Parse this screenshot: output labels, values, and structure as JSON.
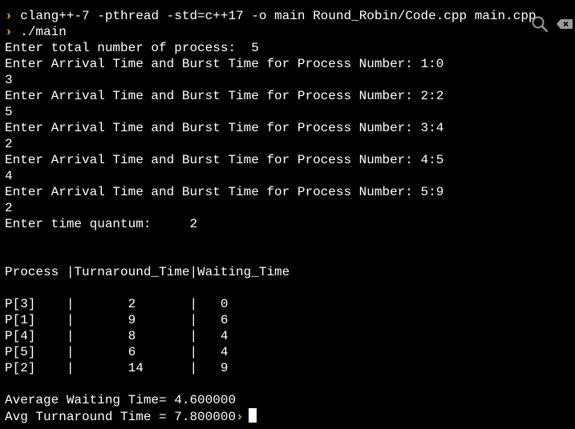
{
  "terminal": {
    "prompt_symbol": "›",
    "command1": "clang++-7 -pthread -std=c++17 -o main Round_Robin/Code.cpp main.cpp",
    "command2": "./main",
    "output": [
      "Enter total number of process:  5",
      "Enter Arrival Time and Burst Time for Process Number: 1:0",
      "3",
      "Enter Arrival Time and Burst Time for Process Number: 2:2",
      "5",
      "Enter Arrival Time and Burst Time for Process Number: 3:4",
      "2",
      "Enter Arrival Time and Burst Time for Process Number: 4:5",
      "4",
      "Enter Arrival Time and Burst Time for Process Number: 5:9",
      "2",
      "Enter time quantum:     2",
      "",
      "",
      "Process |Turnaround_Time|Waiting_Time",
      "",
      "P[3]    |       2       |   0",
      "P[1]    |       9       |   6",
      "P[4]    |       8       |   4",
      "P[5]    |       6       |   4",
      "P[2]    |       14      |   9",
      "",
      "Average Waiting Time= 4.600000",
      "Avg Turnaround Time = 7.800000"
    ]
  },
  "toolbar": {
    "search_icon": "search-icon",
    "clear_icon": "clear-icon"
  },
  "colors": {
    "background": "#000000",
    "text": "#ffffff",
    "prompt": "#f5a623",
    "icon": "#9a9a9a"
  }
}
